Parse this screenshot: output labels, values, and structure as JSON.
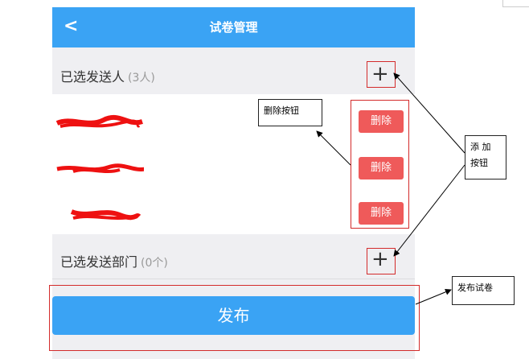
{
  "header": {
    "title": "试卷管理",
    "back_icon": "chevron-left-icon"
  },
  "recipients_section": {
    "label": "已选发送人",
    "count": "(3人)",
    "add_icon": "plus-icon"
  },
  "recipients": [
    {
      "delete_label": "删除"
    },
    {
      "delete_label": "删除"
    },
    {
      "delete_label": "删除"
    }
  ],
  "departments_section": {
    "label": "已选发送部门",
    "count": "(0个)",
    "add_icon": "plus-icon"
  },
  "publish_button": {
    "label": "发布"
  },
  "annotations": {
    "delete_note": "删除按钮",
    "add_note": "添 加\n按钮",
    "publish_note": "发布试卷"
  },
  "colors": {
    "accent": "#3aa3f4",
    "delete": "#ef5a5a",
    "annotation_outline": "#d32b2b",
    "scribble": "#ee1111"
  }
}
